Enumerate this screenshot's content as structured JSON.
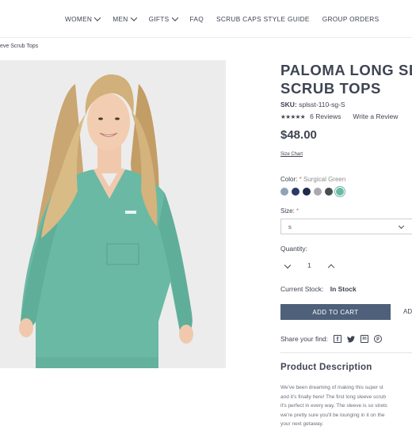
{
  "nav": {
    "items": [
      {
        "label": "WOMEN",
        "dropdown": true
      },
      {
        "label": "MEN",
        "dropdown": true
      },
      {
        "label": "GIFTS",
        "dropdown": true
      },
      {
        "label": "FAQ",
        "dropdown": false
      },
      {
        "label": "SCRUB CAPS STYLE GUIDE",
        "dropdown": false
      },
      {
        "label": "GROUP ORDERS",
        "dropdown": false
      }
    ]
  },
  "breadcrumb": "eve Scrub Tops",
  "product": {
    "title_line1": "PALOMA LONG SL",
    "title_line2": "SCRUB TOPS",
    "sku_label": "SKU:",
    "sku_value": "splsst-110-sg-S",
    "stars": "★★★★★",
    "reviews": "6 Reviews",
    "write_review": "Write a Review",
    "price": "$48.00",
    "size_chart": "Size Chart",
    "color_label": "Color:",
    "color_required": "*",
    "color_value": "Surgical Green",
    "swatches": [
      "#8fa3b8",
      "#2a3a66",
      "#1f2a4d",
      "#a9aaad",
      "#4a4d52",
      "#6ab9a4"
    ],
    "size_label": "Size:",
    "size_required": "*",
    "size_value": "s",
    "quantity_label": "Quantity:",
    "quantity_value": "1",
    "stock_label": "Current Stock:",
    "stock_value": "In Stock",
    "add_to_cart": "ADD TO CART",
    "add_to_cart_2": "AD",
    "share_label": "Share your find:",
    "share_icons": [
      "facebook-icon",
      "twitter-icon",
      "linkedin-icon",
      "pinterest-icon"
    ]
  },
  "description": {
    "title": "Product Description",
    "lines": [
      "We've been dreaming of making this super st",
      "and it's finally here! The first long sleeve scrub",
      "it's perfect in every way. The sleeve is so stretc",
      "we're pretty sure you'll be lounging in it on the",
      "your next getaway."
    ]
  },
  "colors": {
    "accent": "#4e607a",
    "scrub": "#6ab9a4",
    "text": "#3f4453"
  }
}
